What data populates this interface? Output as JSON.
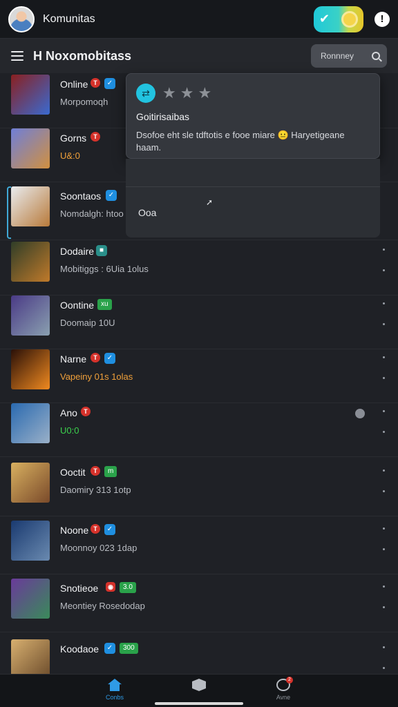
{
  "header": {
    "app_title": "Komunitas"
  },
  "subheader": {
    "page_title": "H Noxomobitass",
    "search_label": "Ronnney"
  },
  "rows": [
    {
      "name": "Online",
      "sub": "Morpomoqh",
      "sub_color": "grey",
      "badges": [
        "red",
        "blue"
      ],
      "thumb": [
        "#8a2020",
        "#3a6ad0"
      ]
    },
    {
      "name": "Gorns",
      "sub": "U&:0",
      "sub_color": "orange",
      "badges": [
        "red"
      ],
      "thumb": [
        "#6f7fd8",
        "#d09040"
      ]
    },
    {
      "name": "Soontaos",
      "sub": "Nomdalgh: htoo",
      "sub_color": "grey",
      "badges": [
        "blue"
      ],
      "thumb": [
        "#e9ecef",
        "#b87a3a"
      ],
      "selected": true
    },
    {
      "name": "Dodaire",
      "sub": "Mobitiggs : 6Uia 1olus",
      "sub_color": "grey",
      "badges": [
        "teal"
      ],
      "thumb": [
        "#2f3d28",
        "#c07a2a"
      ]
    },
    {
      "name": "Oontine",
      "sub": "Doomaip 10U",
      "sub_color": "grey",
      "badges": [
        "green:xu"
      ],
      "thumb": [
        "#4a3a86",
        "#8aa0b0"
      ]
    },
    {
      "name": "Narne",
      "sub": "Vapeiny   01s 1olas",
      "sub_color": "orange",
      "badges": [
        "red",
        "blue"
      ],
      "thumb": [
        "#2a1008",
        "#f08a20"
      ]
    },
    {
      "name": "Ano",
      "sub": "U0:0",
      "sub_color": "green",
      "badges": [
        "red"
      ],
      "thumb": [
        "#2a6ab0",
        "#9ab0c8"
      ]
    },
    {
      "name": "Ooctit",
      "sub": "Daomiry    313 1otp",
      "sub_color": "grey",
      "badges": [
        "red",
        "green:m"
      ],
      "thumb": [
        "#d8b060",
        "#7a4a2a"
      ]
    },
    {
      "name": "Noone",
      "sub": "Moonnoy    023 1dap",
      "sub_color": "grey",
      "badges": [
        "red",
        "blue"
      ],
      "thumb": [
        "#1a3a70",
        "#6a8ab0"
      ]
    },
    {
      "name": "Snotieoe",
      "sub": "Meontiey    Rosedodap",
      "sub_color": "grey",
      "badges": [
        "redsq",
        "green:3.0"
      ],
      "thumb": [
        "#6a3a9a",
        "#3a8a5a"
      ]
    },
    {
      "name": "Koodaoe",
      "sub": "",
      "sub_color": "grey",
      "badges": [
        "blue",
        "green:300"
      ],
      "thumb": [
        "#d8b070",
        "#6a4a2a"
      ]
    }
  ],
  "popup": {
    "stars_filled": 0,
    "stars_total": 3,
    "title": "Goitirisaibas",
    "body": "Dsofoe eht sle tdftotis e fooe miare 😐 Haryetigeane haam.",
    "lower_text": "Ooa"
  },
  "bottom_nav": [
    {
      "label": "Conbs",
      "icon": "home-icon",
      "active": true
    },
    {
      "label": "",
      "icon": "cube-icon",
      "active": false
    },
    {
      "label": "Avne",
      "icon": "profile-icon",
      "active": false,
      "badge": "2"
    }
  ],
  "colors": {
    "accent_blue": "#2f9be6",
    "badge_red": "#d5322b",
    "badge_green": "#2aa24a",
    "orange_text": "#f0a03a",
    "green_text": "#3bd14d"
  }
}
